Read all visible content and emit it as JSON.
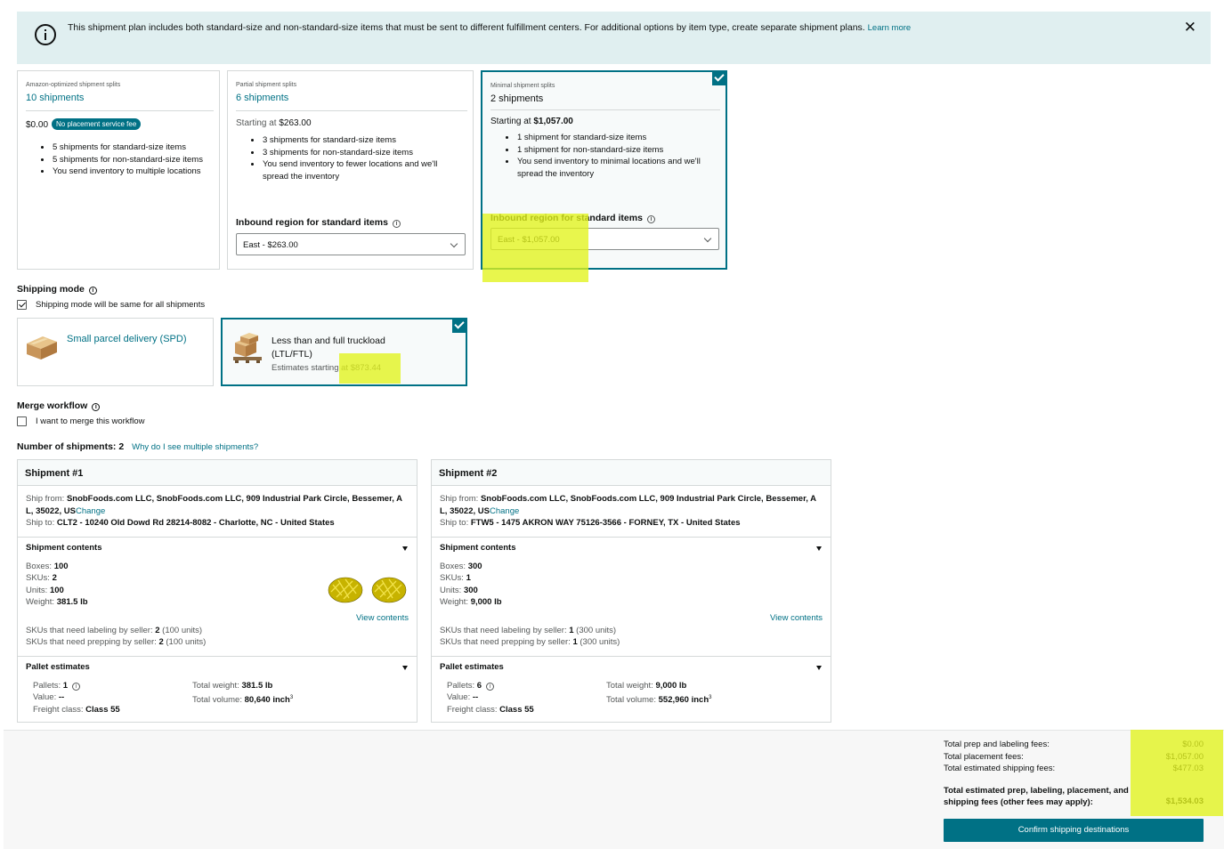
{
  "banner": {
    "message": "This shipment plan includes both standard-size and non-standard-size items that must be sent to different fulfillment centers. For additional options by item type, create separate shipment plans.",
    "link": "Learn more",
    "close": "✕"
  },
  "splits": [
    {
      "small_label": "Amazon-optimized shipment splits",
      "title": "10 shipments",
      "price": "$0.00",
      "badge": "No placement service fee",
      "bullets": [
        "5 shipments for standard-size items",
        "5 shipments for non-standard-size items",
        "You send inventory to multiple locations"
      ],
      "selected": false
    },
    {
      "small_label": "Partial shipment splits",
      "title": "6 shipments",
      "price_prefix": "Starting at",
      "price": "$263.00",
      "bullets": [
        "3 shipments for standard-size items",
        "3 shipments for non-standard-size items",
        "You send inventory to fewer locations and we'll",
        "spread the inventory"
      ],
      "region_label": "Inbound region for standard items",
      "region_value": "East - $263.00",
      "selected": false
    },
    {
      "small_label": "Minimal shipment splits",
      "title": "2 shipments",
      "price_prefix": "Starting at",
      "price": "$1,057.00",
      "bullets": [
        "1 shipment for standard-size items",
        "1 shipment for non-standard-size items",
        "You send inventory to minimal locations and we'll",
        "spread the inventory"
      ],
      "region_label": "Inbound region for standard items",
      "region_value": "East - $1,057.00",
      "selected": true
    }
  ],
  "shipping_mode": {
    "heading": "Shipping mode",
    "same_label": "Shipping mode will be same for all shipments",
    "same_checked": true,
    "options": [
      {
        "title": "Small parcel delivery (SPD)",
        "selected": false
      },
      {
        "title_line1": "Less than and full truckload",
        "title_line2": "(LTL/FTL)",
        "estimate_prefix": "Estimates starting at",
        "estimate": "$873.44",
        "selected": true
      }
    ]
  },
  "merge": {
    "heading": "Merge workflow",
    "checkbox_label": "I want to merge this workflow",
    "checked": false
  },
  "shipments_count": {
    "label": "Number of shipments:",
    "value": "2",
    "link": "Why do I see multiple shipments?"
  },
  "shipments": [
    {
      "title": "Shipment #1",
      "ship_from_label": "Ship from:",
      "ship_from_line1": "SnobFoods.com LLC, SnobFoods.com LLC, 909 Industrial Park Circle,  Bessemer,  A",
      "ship_from_line2": "L,  35022,  US",
      "change": "Change",
      "ship_to_label": "Ship to:",
      "ship_to": "CLT2 -  10240 Old Dowd Rd  28214-8082 -  Charlotte,  NC -  United States",
      "contents_heading": "Shipment contents",
      "boxes_label": "Boxes:",
      "boxes": "100",
      "skus_label": "SKUs:",
      "skus": "2",
      "units_label": "Units:",
      "units": "100",
      "weight_label": "Weight:",
      "weight": "381.5 lb",
      "view_contents": "View contents",
      "labeling_label": "SKUs that need labeling by seller:",
      "labeling_count": "2",
      "labeling_units": "(100 units)",
      "prepping_label": "SKUs that need prepping by seller:",
      "prepping_count": "2",
      "prepping_units": "(100 units)",
      "pallet_heading": "Pallet estimates",
      "pallets_label": "Pallets:",
      "pallets": "1",
      "value_label": "Value:",
      "value": "--",
      "freight_label": "Freight class:",
      "freight": "Class 55",
      "total_weight_label": "Total weight:",
      "total_weight": "381.5 lb",
      "total_volume_label": "Total volume:",
      "total_volume": "80,640 inch",
      "volume_exp": "3"
    },
    {
      "title": "Shipment #2",
      "ship_from_label": "Ship from:",
      "ship_from_line1": "SnobFoods.com LLC, SnobFoods.com LLC, 909 Industrial Park Circle,  Bessemer,  A",
      "ship_from_line2": "L,  35022,  US",
      "change": "Change",
      "ship_to_label": "Ship to:",
      "ship_to": "FTW5 -  1475 AKRON WAY  75126-3566 -  FORNEY,  TX -  United States",
      "contents_heading": "Shipment contents",
      "boxes_label": "Boxes:",
      "boxes": "300",
      "skus_label": "SKUs:",
      "skus": "1",
      "units_label": "Units:",
      "units": "300",
      "weight_label": "Weight:",
      "weight": "9,000 lb",
      "view_contents": "View contents",
      "labeling_label": "SKUs that need labeling by seller:",
      "labeling_count": "1",
      "labeling_units": "(300 units)",
      "prepping_label": "SKUs that need prepping by seller:",
      "prepping_count": "1",
      "prepping_units": "(300 units)",
      "pallet_heading": "Pallet estimates",
      "pallets_label": "Pallets:",
      "pallets": "6",
      "value_label": "Value:",
      "value": "--",
      "freight_label": "Freight class:",
      "freight": "Class 55",
      "total_weight_label": "Total weight:",
      "total_weight": "9,000 lb",
      "total_volume_label": "Total volume:",
      "total_volume": "552,960 inch",
      "volume_exp": "3"
    }
  ],
  "summary": {
    "prep_label": "Total prep and labeling fees:",
    "prep": "$0.00",
    "placement_label": "Total placement fees:",
    "placement": "$1,057.00",
    "shipping_label": "Total estimated shipping fees:",
    "shipping": "$477.03",
    "total_label_line1": "Total estimated prep, labeling, placement, and",
    "total_label_line2": "shipping fees (other fees may apply):",
    "total": "$1,534.03",
    "confirm_button": "Confirm shipping destinations"
  },
  "colors": {
    "accent": "#007185",
    "banner_bg": "#e0eff0",
    "highlight": "#e2f41b"
  },
  "icons": [
    "info-circle-icon",
    "close-icon",
    "check-icon",
    "chevron-down-icon",
    "box-icon",
    "pallet-icon",
    "caret-down-icon"
  ]
}
